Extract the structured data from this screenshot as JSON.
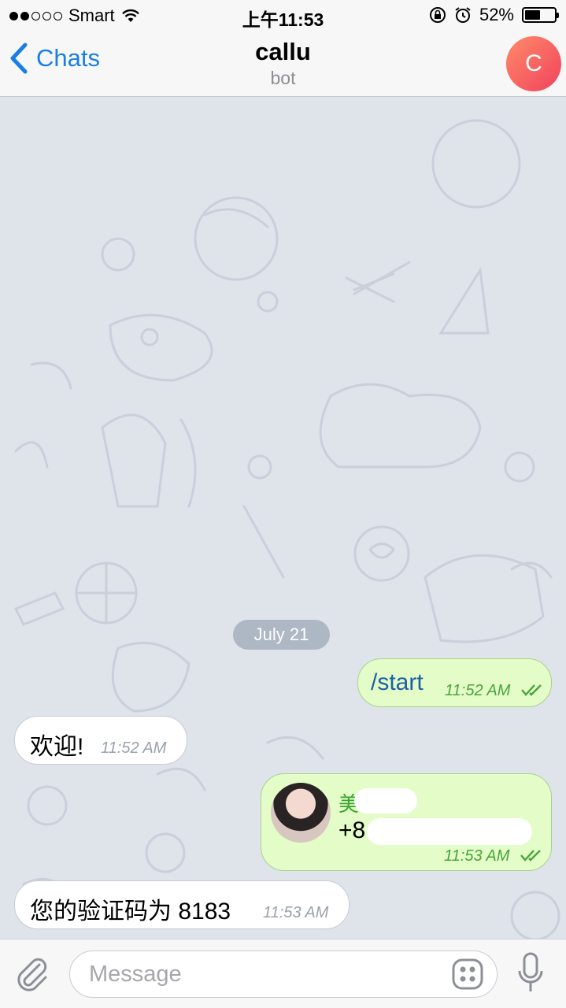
{
  "status_bar": {
    "carrier": "Smart",
    "time": "上午11:53",
    "battery_percent": "52%",
    "battery_level": 0.52
  },
  "nav": {
    "back_label": "Chats",
    "title": "callu",
    "subtitle": "bot",
    "avatar_letter": "C"
  },
  "chat": {
    "date_label": "July 21",
    "messages": [
      {
        "direction": "out",
        "text": "/start",
        "time": "11:52 AM",
        "status": "read"
      },
      {
        "direction": "in",
        "text": "欢迎!",
        "time": "11:52 AM"
      },
      {
        "direction": "out",
        "type": "contact",
        "name": "美",
        "phone": "+8",
        "time": "11:53 AM",
        "status": "read"
      },
      {
        "direction": "in",
        "text": "您的验证码为 8183",
        "time": "11:53 AM"
      }
    ]
  },
  "input": {
    "placeholder": "Message"
  },
  "colors": {
    "accent": "#1a7fe4",
    "outgoing_bubble": "#e3fcc8",
    "incoming_bubble": "#ffffff",
    "chat_background": "#dfe3ea",
    "read_check": "#4aa43c"
  }
}
